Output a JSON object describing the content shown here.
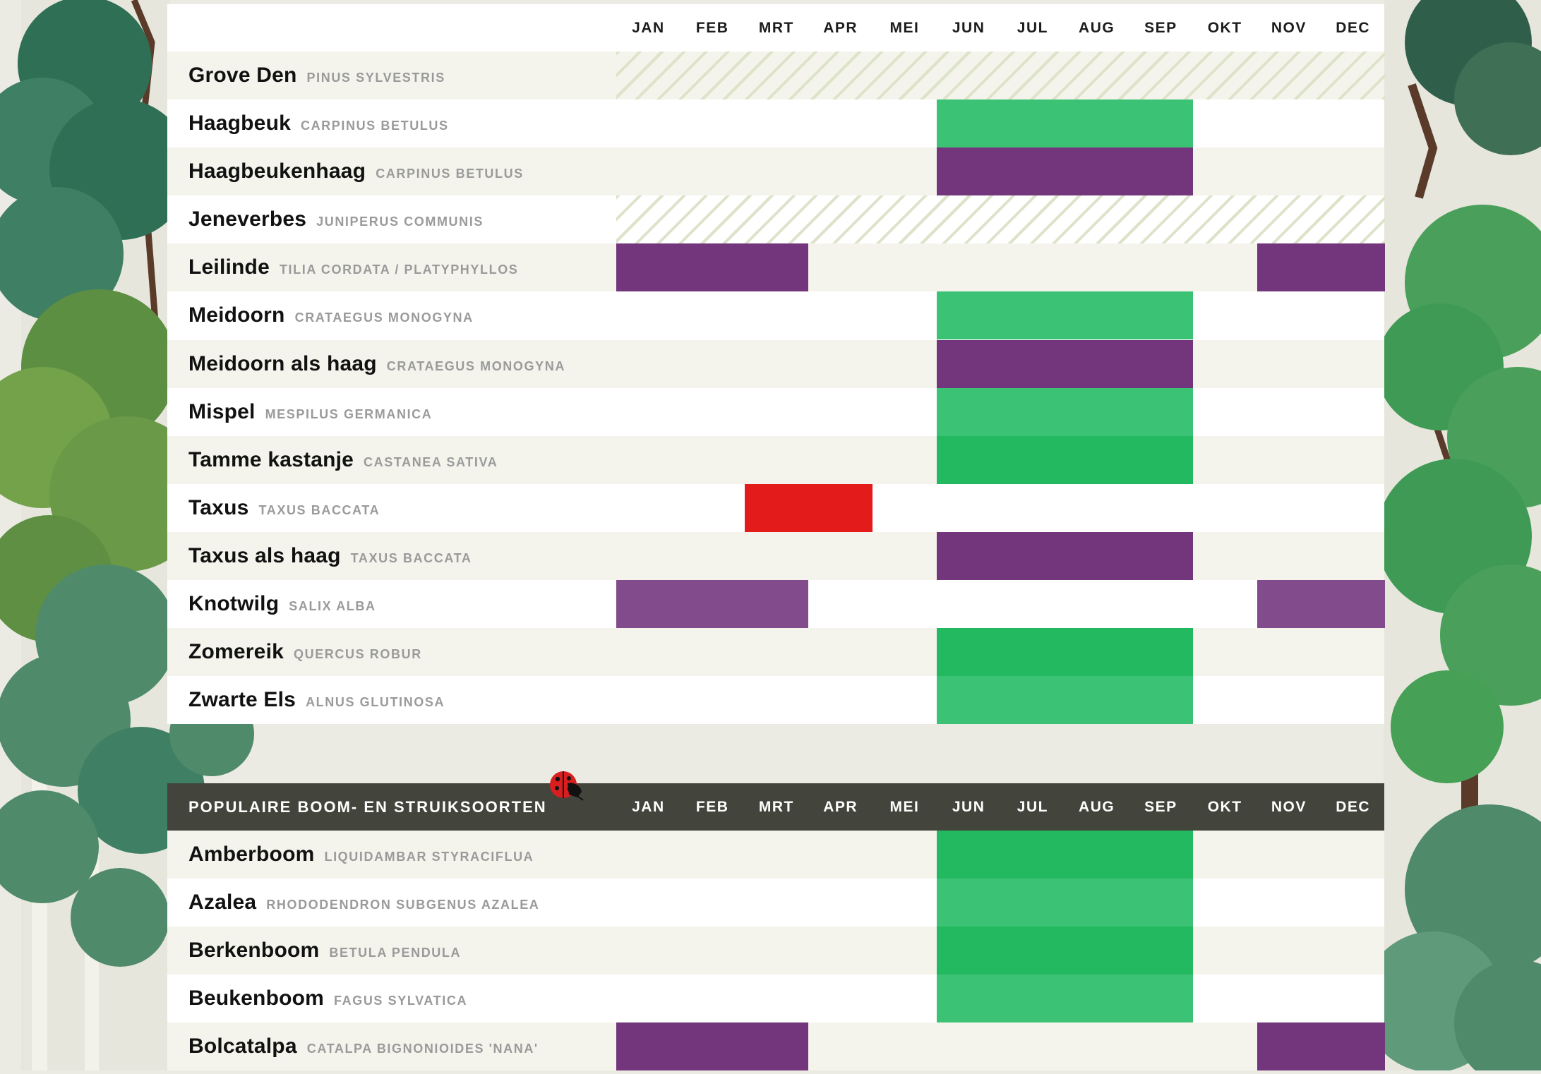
{
  "months": [
    "JAN",
    "FEB",
    "MRT",
    "APR",
    "MEI",
    "JUN",
    "JUL",
    "AUG",
    "SEP",
    "OKT",
    "NOV",
    "DEC"
  ],
  "colors": {
    "green": "#3cc274",
    "green_dark": "#23b960",
    "purple": "#73357c",
    "purple_light": "#824b8b",
    "red": "#e31b1b",
    "hatch": "#dde3c9",
    "header_dark": "#43443b"
  },
  "table1": {
    "rows": [
      {
        "common": "Grove Den",
        "latin": "PINUS SYLVESTRIS",
        "segments": [
          {
            "type": "hatch",
            "start": 1,
            "end": 12
          }
        ]
      },
      {
        "common": "Haagbeuk",
        "latin": "CARPINUS BETULUS",
        "segments": [
          {
            "type": "green",
            "start": 6,
            "end": 9
          }
        ]
      },
      {
        "common": "Haagbeukenhaag",
        "latin": "CARPINUS BETULUS",
        "segments": [
          {
            "type": "purple",
            "start": 6,
            "end": 9
          }
        ]
      },
      {
        "common": "Jeneverbes",
        "latin": "JUNIPERUS COMMUNIS",
        "segments": [
          {
            "type": "hatch",
            "start": 1,
            "end": 12
          }
        ]
      },
      {
        "common": "Leilinde",
        "latin": "TILIA CORDATA / PLATYPHYLLOS",
        "segments": [
          {
            "type": "purple",
            "start": 1,
            "end": 3
          },
          {
            "type": "purple",
            "start": 11,
            "end": 12
          }
        ]
      },
      {
        "common": "Meidoorn",
        "latin": "CRATAEGUS MONOGYNA",
        "segments": [
          {
            "type": "green",
            "start": 6,
            "end": 9
          }
        ]
      },
      {
        "common": "Meidoorn als haag",
        "latin": "CRATAEGUS MONOGYNA",
        "segments": [
          {
            "type": "purple",
            "start": 6,
            "end": 9
          }
        ]
      },
      {
        "common": "Mispel",
        "latin": "MESPILUS GERMANICA",
        "segments": [
          {
            "type": "green",
            "start": 6,
            "end": 9
          }
        ]
      },
      {
        "common": "Tamme kastanje",
        "latin": "CASTANEA SATIVA",
        "segments": [
          {
            "type": "green_dark",
            "start": 6,
            "end": 9
          }
        ]
      },
      {
        "common": "Taxus",
        "latin": "TAXUS BACCATA",
        "segments": [
          {
            "type": "red",
            "start": 3,
            "end": 4
          }
        ]
      },
      {
        "common": "Taxus als haag",
        "latin": "TAXUS BACCATA",
        "segments": [
          {
            "type": "purple",
            "start": 6,
            "end": 9
          }
        ]
      },
      {
        "common": "Knotwilg",
        "latin": "SALIX ALBA",
        "segments": [
          {
            "type": "purple_light",
            "start": 1,
            "end": 3
          },
          {
            "type": "purple_light",
            "start": 11,
            "end": 12
          }
        ]
      },
      {
        "common": "Zomereik",
        "latin": "QUERCUS ROBUR",
        "segments": [
          {
            "type": "green_dark",
            "start": 6,
            "end": 9
          }
        ]
      },
      {
        "common": "Zwarte Els",
        "latin": "ALNUS GLUTINOSA",
        "segments": [
          {
            "type": "green",
            "start": 6,
            "end": 9
          }
        ]
      }
    ]
  },
  "table2": {
    "title": "POPULAIRE BOOM- EN STRUIKSOORTEN",
    "rows": [
      {
        "common": "Amberboom",
        "latin": "LIQUIDAMBAR STYRACIFLUA",
        "segments": [
          {
            "type": "green_dark",
            "start": 6,
            "end": 9
          }
        ]
      },
      {
        "common": "Azalea",
        "latin": "RHODODENDRON SUBGENUS AZALEA",
        "segments": [
          {
            "type": "green",
            "start": 6,
            "end": 9
          }
        ]
      },
      {
        "common": "Berkenboom",
        "latin": "BETULA PENDULA",
        "segments": [
          {
            "type": "green_dark",
            "start": 6,
            "end": 9
          }
        ]
      },
      {
        "common": "Beukenboom",
        "latin": "FAGUS SYLVATICA",
        "segments": [
          {
            "type": "green",
            "start": 6,
            "end": 9
          }
        ]
      },
      {
        "common": "Bolcatalpa",
        "latin": "CATALPA BIGNONIOIDES 'NANA'",
        "segments": [
          {
            "type": "purple",
            "start": 1,
            "end": 3
          },
          {
            "type": "purple",
            "start": 11,
            "end": 12
          }
        ]
      }
    ]
  }
}
